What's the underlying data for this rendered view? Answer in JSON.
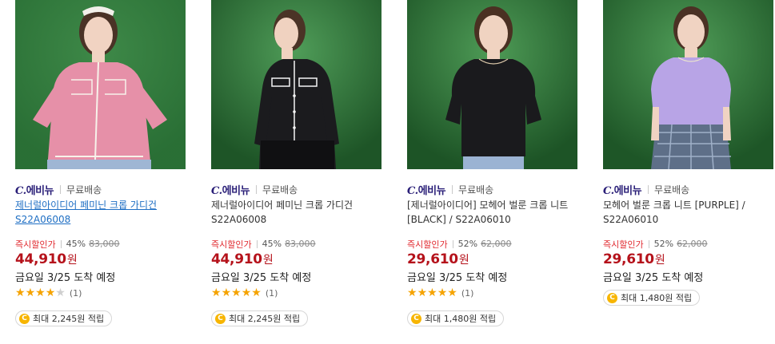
{
  "products": [
    {
      "brand_prefix": "C.",
      "brand_name": "에비뉴",
      "shipping": "무료배송",
      "title": "제너럴아이디어 페미닌 크롭 가디건 S22A06008",
      "discount_label": "즉시할인가",
      "discount_rate": "45%",
      "original_price": "83,000",
      "sale_price": "44,910",
      "currency": "원",
      "delivery": "금요일 3/25 도착 예정",
      "rating_stars": 4,
      "review_count": "(1)",
      "reward": "최대 2,245원 적립",
      "coin_icon": "C",
      "image": {
        "background": "#2f7a3b",
        "top_color": "#e690a8"
      }
    },
    {
      "brand_prefix": "C.",
      "brand_name": "에비뉴",
      "shipping": "무료배송",
      "title": "제너럴아이디어 페미닌 크롭 가디건 S22A06008",
      "discount_label": "즉시할인가",
      "discount_rate": "45%",
      "original_price": "83,000",
      "sale_price": "44,910",
      "currency": "원",
      "delivery": "금요일 3/25 도착 예정",
      "rating_stars": 5,
      "review_count": "(1)",
      "reward": "최대 2,245원 적립",
      "coin_icon": "C",
      "image": {
        "background": "#2f7a3b",
        "top_color": "#1b1b1e"
      }
    },
    {
      "brand_prefix": "C.",
      "brand_name": "에비뉴",
      "shipping": "무료배송",
      "title": "[제너럴아이디어] 모헤어 벌룬 크롭 니트 [BLACK] / S22A06010",
      "discount_label": "즉시할인가",
      "discount_rate": "52%",
      "original_price": "62,000",
      "sale_price": "29,610",
      "currency": "원",
      "delivery": "금요일 3/25 도착 예정",
      "rating_stars": 5,
      "review_count": "(1)",
      "reward": "최대 1,480원 적립",
      "coin_icon": "C",
      "image": {
        "background": "#2f7a3b",
        "top_color": "#1a1a1d"
      }
    },
    {
      "brand_prefix": "C.",
      "brand_name": "에비뉴",
      "shipping": "무료배송",
      "title": "모헤어 벌룬 크롭 니트 [PURPLE] / S22A06010",
      "discount_label": "즉시할인가",
      "discount_rate": "52%",
      "original_price": "62,000",
      "sale_price": "29,610",
      "currency": "원",
      "delivery": "금요일 3/25 도착 예정",
      "rating_stars": 0,
      "review_count": "",
      "reward": "최대 1,480원 적립",
      "coin_icon": "C",
      "image": {
        "background": "#2f7a3b",
        "top_color": "#b8a4e6"
      }
    }
  ]
}
